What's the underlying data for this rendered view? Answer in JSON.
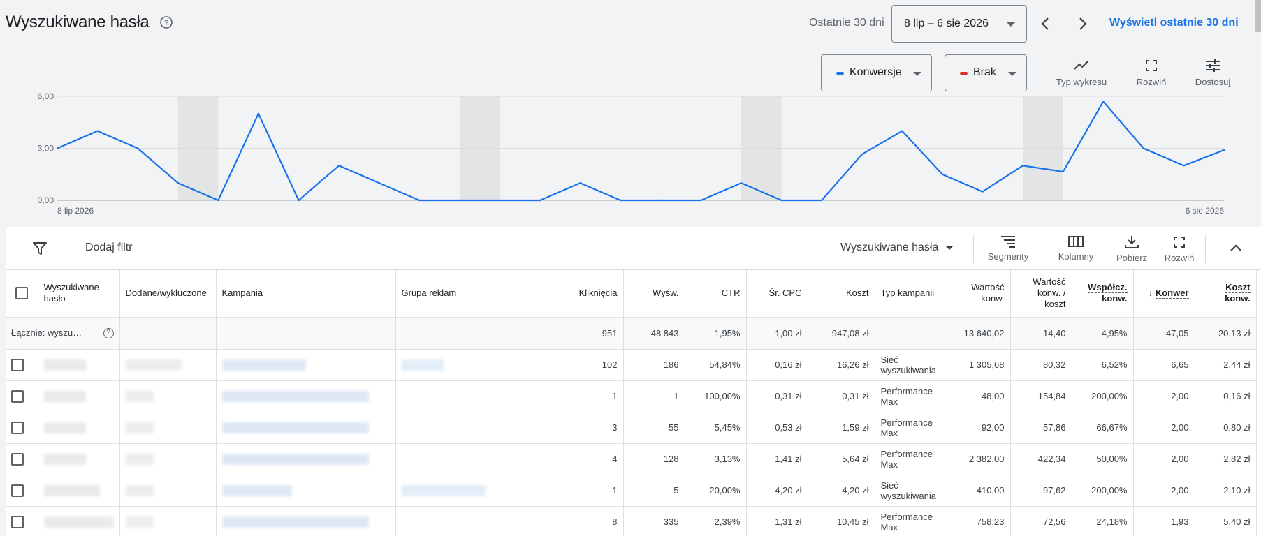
{
  "header": {
    "title": "Wyszukiwane hasła",
    "date_label": "Ostatnie 30 dni",
    "date_range": "8 lip – 6 sie 2026",
    "show_last30": "Wyświetl ostatnie 30 dni"
  },
  "chart_toolbar": {
    "metric1": "Konwersje",
    "metric1_color": "#1a73e8",
    "metric2": "Brak",
    "metric2_color": "#d93025",
    "chart_type": "Typ wykresu",
    "expand": "Rozwiń",
    "customize": "Dostosuj"
  },
  "chart_data": {
    "type": "line",
    "series": [
      {
        "name": "Konwersje",
        "color": "#1a73e8",
        "values": [
          3.0,
          4.0,
          3.0,
          1.0,
          0.0,
          5.0,
          0.0,
          2.0,
          1.0,
          0.0,
          0.0,
          0.0,
          0.0,
          1.0,
          0.0,
          0.0,
          0.0,
          1.0,
          0.0,
          0.0,
          2.65,
          4.0,
          1.5,
          0.5,
          2.0,
          1.65,
          5.7,
          3.0,
          2.0,
          2.9
        ]
      }
    ],
    "ylim": [
      0,
      6
    ],
    "y_ticks": [
      "6,00",
      "3,00",
      "0,00"
    ],
    "x_start_label": "8 lip 2026",
    "x_end_label": "6 sie 2026",
    "weekend_bands": [
      [
        3,
        4
      ],
      [
        10,
        11
      ],
      [
        17,
        18
      ],
      [
        24,
        25
      ]
    ],
    "grid": true
  },
  "filterbar": {
    "add_filter": "Dodaj filtr",
    "view": "Wyszukiwane hasła",
    "segments": "Segmenty",
    "columns": "Kolumny",
    "download": "Pobierz",
    "expand": "Rozwiń"
  },
  "table": {
    "headers": {
      "term": "Wyszukiwane hasło",
      "added": "Dodane/wykluczone",
      "campaign": "Kampania",
      "adgroup": "Grupa reklam",
      "clicks": "Kliknięcia",
      "impr": "Wyśw.",
      "ctr": "CTR",
      "cpc": "Śr. CPC",
      "cost": "Koszt",
      "camptype": "Typ kampanii",
      "convval": "Wartość konw.",
      "valcost": "Wartość konw. / koszt",
      "convrate": "Współcz. konw.",
      "conv": "Konwer",
      "costconv": "Koszt konw."
    },
    "total": {
      "label": "Łącznie: wyszu…",
      "clicks": "951",
      "impr": "48 843",
      "ctr": "1,95%",
      "cpc": "1,00 zł",
      "cost": "947,08 zł",
      "convval": "13 640,02",
      "valcost": "14,40",
      "convrate": "4,95%",
      "conv": "47,05",
      "costconv": "20,13 zł"
    },
    "rows": [
      {
        "clicks": "102",
        "impr": "186",
        "ctr": "54,84%",
        "cpc": "0,16 zł",
        "cost": "16,26 zł",
        "type1": "Sieć",
        "type2": "wyszukiwania",
        "convval": "1 305,68",
        "valcost": "80,32",
        "convrate": "6,52%",
        "conv": "6,65",
        "costconv": "2,44 zł"
      },
      {
        "clicks": "1",
        "impr": "1",
        "ctr": "100,00%",
        "cpc": "0,31 zł",
        "cost": "0,31 zł",
        "type1": "Performance",
        "type2": "Max",
        "convval": "48,00",
        "valcost": "154,84",
        "convrate": "200,00%",
        "conv": "2,00",
        "costconv": "0,16 zł"
      },
      {
        "clicks": "3",
        "impr": "55",
        "ctr": "5,45%",
        "cpc": "0,53 zł",
        "cost": "1,59 zł",
        "type1": "Performance",
        "type2": "Max",
        "convval": "92,00",
        "valcost": "57,86",
        "convrate": "66,67%",
        "conv": "2,00",
        "costconv": "0,80 zł"
      },
      {
        "clicks": "4",
        "impr": "128",
        "ctr": "3,13%",
        "cpc": "1,41 zł",
        "cost": "5,64 zł",
        "type1": "Performance",
        "type2": "Max",
        "convval": "2 382,00",
        "valcost": "422,34",
        "convrate": "50,00%",
        "conv": "2,00",
        "costconv": "2,82 zł"
      },
      {
        "clicks": "1",
        "impr": "5",
        "ctr": "20,00%",
        "cpc": "4,20 zł",
        "cost": "4,20 zł",
        "type1": "Sieć",
        "type2": "wyszukiwania",
        "convval": "410,00",
        "valcost": "97,62",
        "convrate": "200,00%",
        "conv": "2,00",
        "costconv": "2,10 zł"
      },
      {
        "clicks": "8",
        "impr": "335",
        "ctr": "2,39%",
        "cpc": "1,31 zł",
        "cost": "10,45 zł",
        "type1": "Performance",
        "type2": "Max",
        "convval": "758,23",
        "valcost": "72,56",
        "convrate": "24,18%",
        "conv": "1,93",
        "costconv": "5,40 zł"
      }
    ]
  }
}
